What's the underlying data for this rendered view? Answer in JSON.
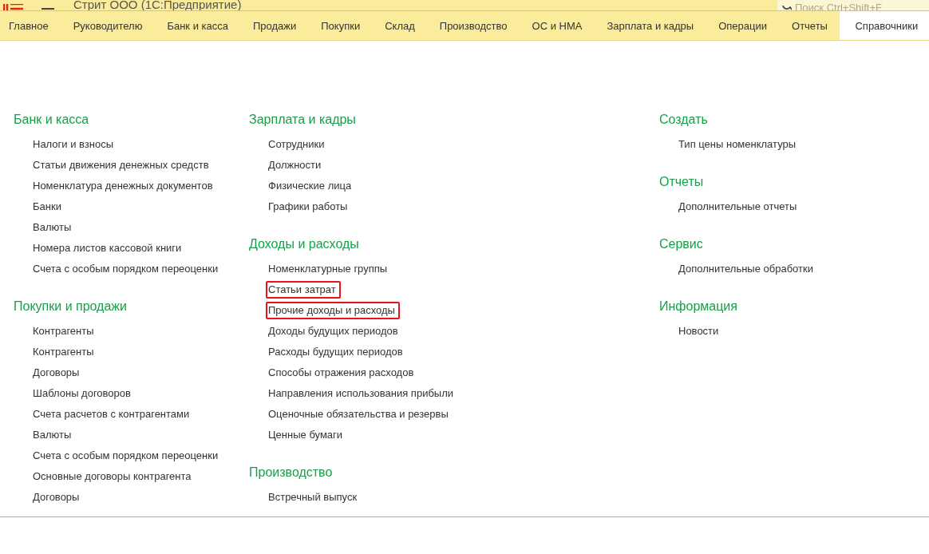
{
  "window": {
    "title": "Стрит ООО  (1С:Предприятие)",
    "search": {
      "placeholder": "Поиск Ctrl+Shift+F"
    }
  },
  "tabs": [
    {
      "label": "Главное",
      "selected": false
    },
    {
      "label": "Руководителю",
      "selected": false
    },
    {
      "label": "Банк и касса",
      "selected": false
    },
    {
      "label": "Продажи",
      "selected": false
    },
    {
      "label": "Покупки",
      "selected": false
    },
    {
      "label": "Склад",
      "selected": false
    },
    {
      "label": "Производство",
      "selected": false
    },
    {
      "label": "ОС и НМА",
      "selected": false
    },
    {
      "label": "Зарплата и кадры",
      "selected": false
    },
    {
      "label": "Операции",
      "selected": false
    },
    {
      "label": "Отчеты",
      "selected": false
    },
    {
      "label": "Справочники",
      "selected": true
    }
  ],
  "columns": [
    [
      {
        "title": "Банк и касса",
        "items": [
          {
            "label": "Налоги и взносы",
            "highlighted": false
          },
          {
            "label": "Статьи движения денежных средств",
            "highlighted": false
          },
          {
            "label": "Номенклатура денежных документов",
            "highlighted": false
          },
          {
            "label": "Банки",
            "highlighted": false
          },
          {
            "label": "Валюты",
            "highlighted": false
          },
          {
            "label": "Номера листов кассовой книги",
            "highlighted": false
          },
          {
            "label": "Счета с особым порядком переоценки",
            "highlighted": false
          }
        ]
      },
      {
        "title": "Покупки и продажи",
        "items": [
          {
            "label": "Контрагенты",
            "highlighted": false
          },
          {
            "label": "Контрагенты",
            "highlighted": false
          },
          {
            "label": "Договоры",
            "highlighted": false
          },
          {
            "label": "Шаблоны договоров",
            "highlighted": false
          },
          {
            "label": "Счета расчетов с контрагентами",
            "highlighted": false
          },
          {
            "label": "Валюты",
            "highlighted": false
          },
          {
            "label": "Счета с особым порядком переоценки",
            "highlighted": false
          },
          {
            "label": "Основные договоры контрагента",
            "highlighted": false
          },
          {
            "label": "Договоры",
            "highlighted": false
          }
        ]
      }
    ],
    [
      {
        "title": "Зарплата и кадры",
        "items": [
          {
            "label": "Сотрудники",
            "highlighted": false
          },
          {
            "label": "Должности",
            "highlighted": false
          },
          {
            "label": "Физические лица",
            "highlighted": false
          },
          {
            "label": "Графики работы",
            "highlighted": false
          }
        ]
      },
      {
        "title": "Доходы и расходы",
        "items": [
          {
            "label": "Номенклатурные группы",
            "highlighted": false
          },
          {
            "label": "Статьи затрат",
            "highlighted": true
          },
          {
            "label": "Прочие доходы и расходы",
            "highlighted": true
          },
          {
            "label": "Доходы будущих периодов",
            "highlighted": false
          },
          {
            "label": "Расходы будущих периодов",
            "highlighted": false
          },
          {
            "label": "Способы отражения расходов",
            "highlighted": false
          },
          {
            "label": "Направления использования прибыли",
            "highlighted": false
          },
          {
            "label": "Оценочные обязательства и резервы",
            "highlighted": false
          },
          {
            "label": "Ценные бумаги",
            "highlighted": false
          }
        ]
      },
      {
        "title": "Производство",
        "items": [
          {
            "label": "Встречный выпуск",
            "highlighted": false
          }
        ]
      }
    ],
    [
      {
        "title": "Создать",
        "items": [
          {
            "label": "Тип цены номенклатуры",
            "highlighted": false
          }
        ]
      },
      {
        "title": "Отчеты",
        "items": [
          {
            "label": "Дополнительные отчеты",
            "highlighted": false
          }
        ]
      },
      {
        "title": "Сервис",
        "items": [
          {
            "label": "Дополнительные обработки",
            "highlighted": false
          }
        ]
      },
      {
        "title": "Информация",
        "items": [
          {
            "label": "Новости",
            "highlighted": false
          }
        ]
      }
    ]
  ]
}
